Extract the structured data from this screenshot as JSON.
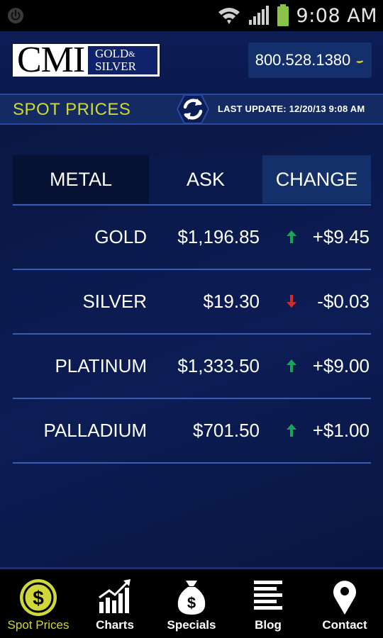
{
  "status_bar": {
    "time": "9:08 AM"
  },
  "header": {
    "logo_main": "CMI",
    "logo_line1": "GOLD",
    "logo_amp": "&",
    "logo_line2": "SILVER",
    "phone": "800.528.1380"
  },
  "spot_bar": {
    "title": "SPOT PRICES",
    "last_update": "LAST UPDATE: 12/20/13 9:08 AM"
  },
  "table": {
    "headers": {
      "metal": "METAL",
      "ask": "ASK",
      "change": "CHANGE"
    },
    "rows": [
      {
        "metal": "GOLD",
        "ask": "$1,196.85",
        "direction": "up",
        "change": "+$9.45"
      },
      {
        "metal": "SILVER",
        "ask": "$19.30",
        "direction": "down",
        "change": "-$0.03"
      },
      {
        "metal": "PLATINUM",
        "ask": "$1,333.50",
        "direction": "up",
        "change": "+$9.00"
      },
      {
        "metal": "PALLADIUM",
        "ask": "$701.50",
        "direction": "up",
        "change": "+$1.00"
      }
    ]
  },
  "nav": {
    "items": [
      {
        "label": "Spot Prices",
        "icon": "dollar-coin-icon",
        "active": true
      },
      {
        "label": "Charts",
        "icon": "bar-chart-icon",
        "active": false
      },
      {
        "label": "Specials",
        "icon": "money-bag-icon",
        "active": false
      },
      {
        "label": "Blog",
        "icon": "text-lines-icon",
        "active": false
      },
      {
        "label": "Contact",
        "icon": "map-pin-icon",
        "active": false
      }
    ]
  },
  "colors": {
    "accent": "#cfd83a",
    "up": "#1aa35a",
    "down": "#d42a2a",
    "background": "#0a1744"
  }
}
